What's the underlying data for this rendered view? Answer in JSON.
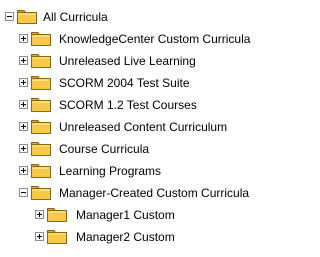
{
  "tree": {
    "root": {
      "label": "All Curricula",
      "expanded": true,
      "icon": "folder-icon"
    },
    "children": [
      {
        "label": "KnowledgeCenter Custom Curricula",
        "expanded": false,
        "icon": "folder-icon"
      },
      {
        "label": "Unreleased Live Learning",
        "expanded": false,
        "icon": "folder-icon"
      },
      {
        "label": "SCORM 2004 Test Suite",
        "expanded": false,
        "icon": "folder-icon"
      },
      {
        "label": "SCORM 1.2 Test Courses",
        "expanded": false,
        "icon": "folder-icon"
      },
      {
        "label": "Unreleased Content Curriculum",
        "expanded": false,
        "icon": "folder-icon"
      },
      {
        "label": "Course Curricula",
        "expanded": false,
        "icon": "folder-icon"
      },
      {
        "label": "Learning Programs",
        "expanded": false,
        "icon": "folder-icon"
      },
      {
        "label": "Manager-Created Custom Curricula",
        "expanded": true,
        "icon": "folder-icon",
        "children": [
          {
            "label": "Manager1 Custom",
            "expanded": false,
            "icon": "folder-icon"
          },
          {
            "label": "Manager2 Custom",
            "expanded": false,
            "icon": "folder-icon"
          }
        ]
      }
    ]
  },
  "colors": {
    "folder_fill": "#f7c948",
    "folder_stroke": "#8a6a12",
    "toggle_border": "#8e8e8e",
    "text": "#000000",
    "background": "#ffffff"
  }
}
